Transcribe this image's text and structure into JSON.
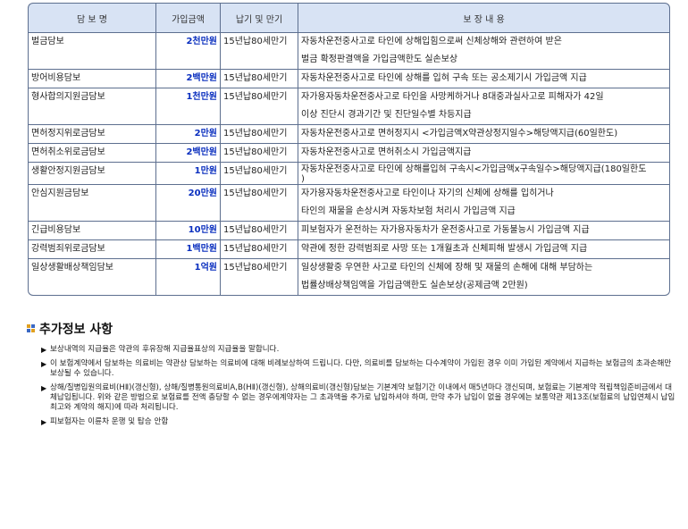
{
  "table": {
    "headers": [
      "담   보   명",
      "가입금액",
      "납기 및 만기",
      "보          장          내          용"
    ],
    "rows": [
      {
        "name": "벌금담보",
        "amount": "2천만원",
        "term": "15년납80세만기",
        "desc": [
          "자동차운전중사고로 타인에 상해입힘으로써 신체상해와 관련하여 받은",
          "벌금 확정판결액을 가입금액한도 실손보상"
        ]
      },
      {
        "name": "방어비용담보",
        "amount": "2백만원",
        "term": "15년납80세만기",
        "desc": [
          "자동차운전중사고로 타인에 상해를 입혀 구속 또는 공소제기시 가입금액 지급"
        ]
      },
      {
        "name": "형사합의지원금담보",
        "amount": "1천만원",
        "term": "15년납80세만기",
        "desc": [
          "자가용자동차운전중사고로 타인을 사망케하거나 8대중과실사고로 피해자가 42일",
          "이상 진단시 경과기간 및 진단일수별 차등지급"
        ]
      },
      {
        "name": "면허정지위로금담보",
        "amount": "2만원",
        "term": "15년납80세만기",
        "desc": [
          "자동차운전중사고로 면허정지시 <가입금액X약관상정지일수>해당액지급(60일한도)"
        ]
      },
      {
        "name": "면허취소위로금담보",
        "amount": "2백만원",
        "term": "15년납80세만기",
        "desc": [
          "자동차운전중사고로 면허취소시 가입금액지급"
        ]
      },
      {
        "name": "생활안정지원금담보",
        "amount": "1만원",
        "term": "15년납80세만기",
        "desc": [
          "자동차운전중사고로 타인에 상해를입혀 구속시<가입금액x구속일수>해당액지급(180일한도",
          ")"
        ]
      },
      {
        "name": "안심지원금담보",
        "amount": "20만원",
        "term": "15년납80세만기",
        "desc": [
          "자가용자동차운전중사고로 타인이나 자기의 신체에 상해를 입히거나",
          "타인의 재물을 손상시켜 자동차보험 처리시 가입금액 지급"
        ]
      },
      {
        "name": "긴급비용담보",
        "amount": "10만원",
        "term": "15년납80세만기",
        "desc": [
          "피보험자가 운전하는 자가용자동차가 운전중사고로 가동불능시 가입금액 지급"
        ]
      },
      {
        "name": "강력범죄위로금담보",
        "amount": "1백만원",
        "term": "15년납80세만기",
        "desc": [
          "약관에 정한 강력범죄로 사망 또는 1개월초과 신체피해 발생시 가입금액 지급"
        ]
      },
      {
        "name": "일상생활배상책임담보",
        "amount": "1억원",
        "term": "15년납80세만기",
        "desc": [
          "일상생활중 우연한 사고로 타인의 신체에 장해 및 재물의 손해에 대해 부담하는",
          "법률상배상책임액을 가입금액한도 실손보상(공제금액 2만원)"
        ]
      }
    ]
  },
  "section": {
    "title": "추가정보 사항",
    "icon": "grid-squares-icon"
  },
  "notes": [
    "보상내역의 지급율은 약관의 후유장해 지급율표상의 지급율을 말합니다.",
    "이 보험계약에서 담보하는 의료비는 약관상 담보하는 의료비에 대해 비례보상하여 드립니다. 다만, 의료비를 담보하는 다수계약이 가입된 경우 이미 가입된 계약에서 지급하는 보험금의 초과손해만 보상될 수 있습니다.",
    "상해/질병입원의료비(HⅡ)(갱신형), 상해/질병통원의료비A,B(HⅡ)(갱신형), 상해의료비(갱신형)담보는 기본계약 보험기간 이내에서 매5년마다 갱신되며, 보험료는 기본계약 적립책임준비금에서 대체납입됩니다. 위와 같은 방법으로 보험료를 전액 충당할 수 없는 경우에계약자는 그 초과액을 추가로 납입하셔야 하며, 만약 추가 납입이 없을 경우에는 보통약관 제13조(보험료의 납입연체시 납입최고와 계약의 해지)에 따라 처리됩니다.",
    "피보험자는 이륜차 운행 및 탑승 안함"
  ],
  "colors": {
    "amount": "#0a2fbf",
    "header_bg": "#d8e3f4",
    "border": "#5d6f8f"
  }
}
